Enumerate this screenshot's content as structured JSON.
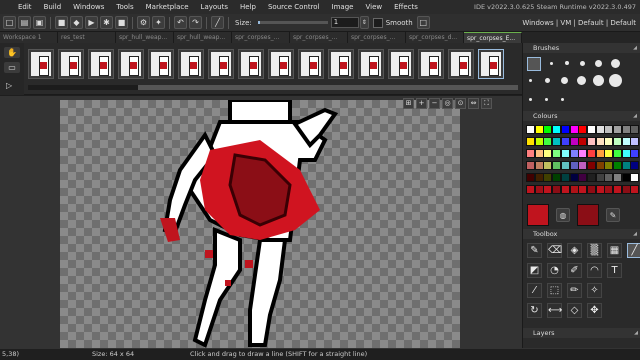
{
  "menubar": {
    "items": [
      "",
      "Edit",
      "Build",
      "Windows",
      "Tools",
      "Marketplace",
      "Layouts",
      "Help",
      "Source Control",
      "Image",
      "View",
      "Effects"
    ],
    "ide_version": "IDE v2022.3.0.625 Steam  Runtime v2022.3.0.497"
  },
  "toolbar": {
    "size_label": "Size:",
    "size_value": "1",
    "smooth_label": "Smooth",
    "layout_info": "Windows | VM | Default | Default"
  },
  "tabs": [
    {
      "label": "Workspace 1",
      "active": false
    },
    {
      "label": "res_test",
      "active": false
    },
    {
      "label": "spr_hull_weap...",
      "active": false
    },
    {
      "label": "spr_hull_weap...",
      "active": false
    },
    {
      "label": "spr_corpses_...",
      "active": false
    },
    {
      "label": "spr_corpses_...",
      "active": false
    },
    {
      "label": "spr_corpses_...",
      "active": false
    },
    {
      "label": "spr_corpses_d...",
      "active": false
    },
    {
      "label": "spr_corpses_E...",
      "active": true
    }
  ],
  "frames": {
    "count": 16,
    "active_index": 15
  },
  "status": {
    "coords": "5,38)",
    "size": "Size: 64 x 64",
    "hint": "Click and drag to draw a line (SHIFT for a straight line)"
  },
  "panels": {
    "brushes": "Brushes",
    "colours": "Colours",
    "toolbox": "Toolbox",
    "layers": "Layers"
  },
  "colors": {
    "primary": "#c0141e",
    "secondary": "#8b0e16",
    "palette": [
      "#ffffff",
      "#ffff00",
      "#00ff00",
      "#00ffff",
      "#0000ff",
      "#ff00ff",
      "#ff0000",
      "#ffffff",
      "#e0e0e0",
      "#c0c0c0",
      "#a0a0a0",
      "#808080",
      "#606060",
      "#ffe000",
      "#c0ff00",
      "#40ff40",
      "#00c0c0",
      "#4040ff",
      "#c000c0",
      "#c00000",
      "#ffc0c0",
      "#ffe0c0",
      "#ffffc0",
      "#c0ffc0",
      "#c0ffff",
      "#c0c0ff",
      "#ff8080",
      "#ffc080",
      "#ffff80",
      "#80ff80",
      "#80ffff",
      "#8080ff",
      "#ff80ff",
      "#ff4040",
      "#ffa040",
      "#ffff40",
      "#40ff40",
      "#40ffff",
      "#4040ff",
      "#c06060",
      "#c08060",
      "#c0c060",
      "#60c060",
      "#60c0c0",
      "#6060c0",
      "#c060c0",
      "#800000",
      "#804000",
      "#808000",
      "#008000",
      "#008080",
      "#000080",
      "#400000",
      "#402000",
      "#404000",
      "#004000",
      "#004040",
      "#000040",
      "#400040",
      "#202020",
      "#404040",
      "#606060",
      "#808080",
      "#000000",
      "#ffffff",
      "#c0141e",
      "#a01018",
      "#c0141e",
      "#8b0e16",
      "#c0141e",
      "#b01218",
      "#c0141e",
      "#900c14",
      "#c0141e",
      "#a01018",
      "#c0141e",
      "#8b0e16",
      "#c0141e"
    ]
  }
}
